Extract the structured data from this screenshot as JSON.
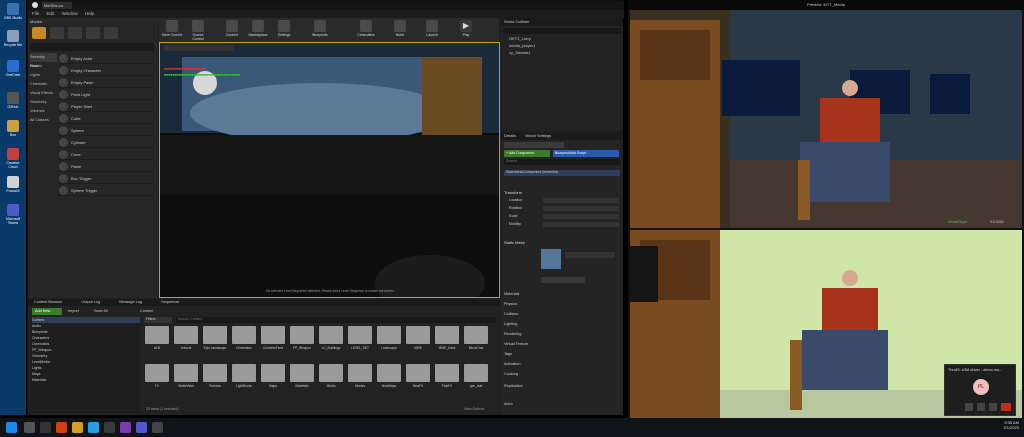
{
  "desktop": {
    "icons": [
      "OBS Studio",
      "Recycle Bin",
      "OneDrive",
      "GitHub",
      "Box",
      "Creative Cloud",
      "FocusUI",
      "Microsoft Teams"
    ]
  },
  "ue": {
    "window_title": "Mtt/Sbs.ca",
    "menu": [
      "File",
      "Edit",
      "Window",
      "Help"
    ],
    "modes_header": "Modes",
    "categories": [
      "Recently Placed",
      "Basic",
      "Lights",
      "Cinematic",
      "Visual Effects",
      "Geometry",
      "Volumes",
      "All Classes"
    ],
    "place_items": [
      "Empty Actor",
      "Empty Character",
      "Empty Pawn",
      "Point Light",
      "Player Start",
      "Cube",
      "Sphere",
      "Cylinder",
      "Cone",
      "Plane",
      "Box Trigger",
      "Sphere Trigger"
    ],
    "toolbar": [
      "Save Current",
      "Source Control",
      "Content",
      "Marketplace",
      "Settings",
      "Blueprints",
      "Cinematics",
      "Build",
      "Launch",
      "Play"
    ],
    "viewport_note": "No selected Level Sequence detected. Please add a Level Sequence to master full-screen",
    "outliner": {
      "title": "World Outliner",
      "rows": [
        "OKT1_Lorry",
        "media_player1",
        "cy_Stream1"
      ]
    },
    "details": {
      "tabs": [
        "Details",
        "World Settings"
      ],
      "add_label": "+ Add Component",
      "bp_label": "Blueprint/Add Script",
      "search": "Search",
      "component": "StaticMeshComponent (Inherited)",
      "sections": [
        "Transform",
        "Static Mesh",
        "Materials",
        "Physics",
        "Collision",
        "Lighting",
        "Rendering",
        "Virtual Texture",
        "Tags",
        "Activation",
        "Cooking",
        "Replication",
        "Actor"
      ],
      "fields": [
        "Location",
        "Rotation",
        "Scale",
        "Mobility"
      ]
    },
    "content": {
      "tabs": [
        "Content Browser",
        "Output Log",
        "Message Log",
        "Sequencer"
      ],
      "add_new": "Add New",
      "import": "Import",
      "save_all": "Save All",
      "path": "Content",
      "filter": "Filters",
      "search": "Search Content",
      "status": "25 items (1 selected)",
      "view": "View Options",
      "folders": [
        "ALB",
        "Artwork",
        "Epic Landscape",
        "Cinematics",
        "ContentsFeed",
        "FP_Weapon",
        "LC_Buildings",
        "LEVEL_SET",
        "Landscape",
        "MWE",
        "MWE_Dack",
        "MicroChat",
        "FX",
        "StaticMesh",
        "Textures",
        "LightBooks",
        "Maps",
        "Materials",
        "Media",
        "Movies",
        "NewMaps",
        "NewFX",
        "PostFX",
        "gen_stat"
      ],
      "tree": [
        "Content",
        "Audio",
        "Blueprints",
        "Characters",
        "Cinematics",
        "FP_Weapon",
        "Geometry",
        "LevelMedia",
        "Lights",
        "Maps",
        "Materials"
      ]
    }
  },
  "preview": {
    "title": "Preview: MTT_Media",
    "badge": "MediaPlayer",
    "stats": "0:0:2440"
  },
  "notif": {
    "title": "ThruDI: USA driver - demo mo...",
    "initials": "PL"
  },
  "clock": {
    "time": "9:35 AM",
    "date": "3/1/2020"
  }
}
